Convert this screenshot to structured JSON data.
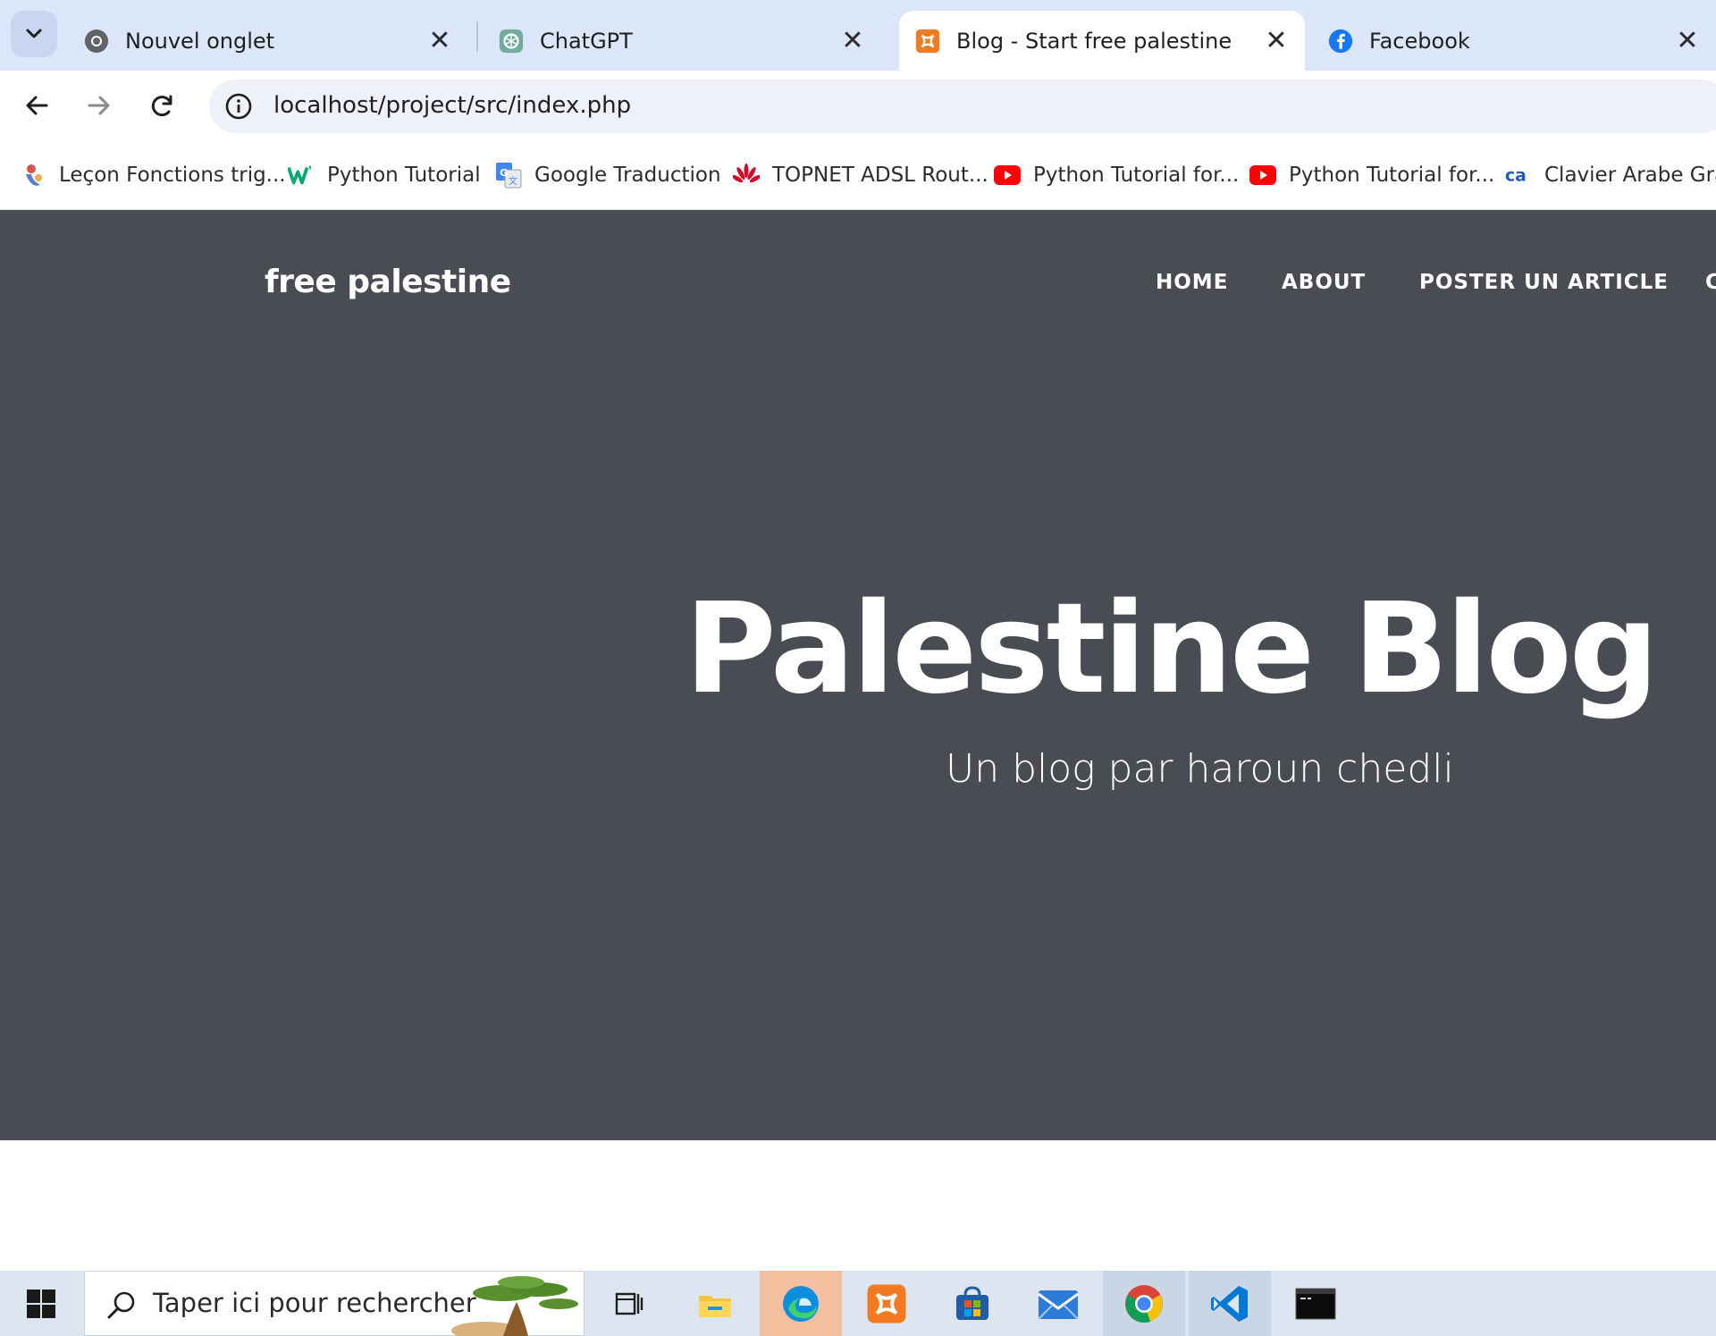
{
  "browser": {
    "tabs": [
      {
        "title": "Nouvel onglet",
        "icon": "chrome-icon",
        "active": false
      },
      {
        "title": "ChatGPT",
        "icon": "chatgpt-icon",
        "active": false
      },
      {
        "title": "Blog - Start free palestine",
        "icon": "xampp-icon",
        "active": true
      },
      {
        "title": "Facebook",
        "icon": "facebook-icon",
        "active": false
      }
    ],
    "close_glyph": "✕",
    "url": "localhost/project/src/index.php",
    "bookmarks": [
      {
        "label": "Leçon Fonctions trig...",
        "icon": "lesson-icon"
      },
      {
        "label": "Python Tutorial",
        "icon": "w3schools-icon"
      },
      {
        "label": "Google Traduction",
        "icon": "google-translate-icon"
      },
      {
        "label": "TOPNET ADSL Rout...",
        "icon": "huawei-icon"
      },
      {
        "label": "Python Tutorial for...",
        "icon": "youtube-icon"
      },
      {
        "label": "Python Tutorial for...",
        "icon": "youtube-icon"
      },
      {
        "label": "Clavier Arabe Gratu",
        "icon": "clavier-arabe-icon"
      }
    ]
  },
  "site": {
    "brand": "free palestine",
    "nav": [
      "HOME",
      "ABOUT",
      "POSTER UN ARTICLE"
    ],
    "hero_title": "Palestine Blog",
    "hero_subtitle": "Un blog par haroun chedli",
    "hero_bg": "#494d53"
  },
  "taskbar": {
    "search_placeholder": "Taper ici pour rechercher",
    "apps": [
      "task-view-icon",
      "file-explorer-icon",
      "edge-icon",
      "xampp-icon",
      "microsoft-store-icon",
      "mail-icon",
      "chrome-icon",
      "vscode-icon",
      "terminal-icon"
    ]
  },
  "colors": {
    "tabstrip": "#dbe6f9",
    "xampp": "#f37a22",
    "facebook": "#1877f2",
    "youtube": "#ff0000"
  }
}
